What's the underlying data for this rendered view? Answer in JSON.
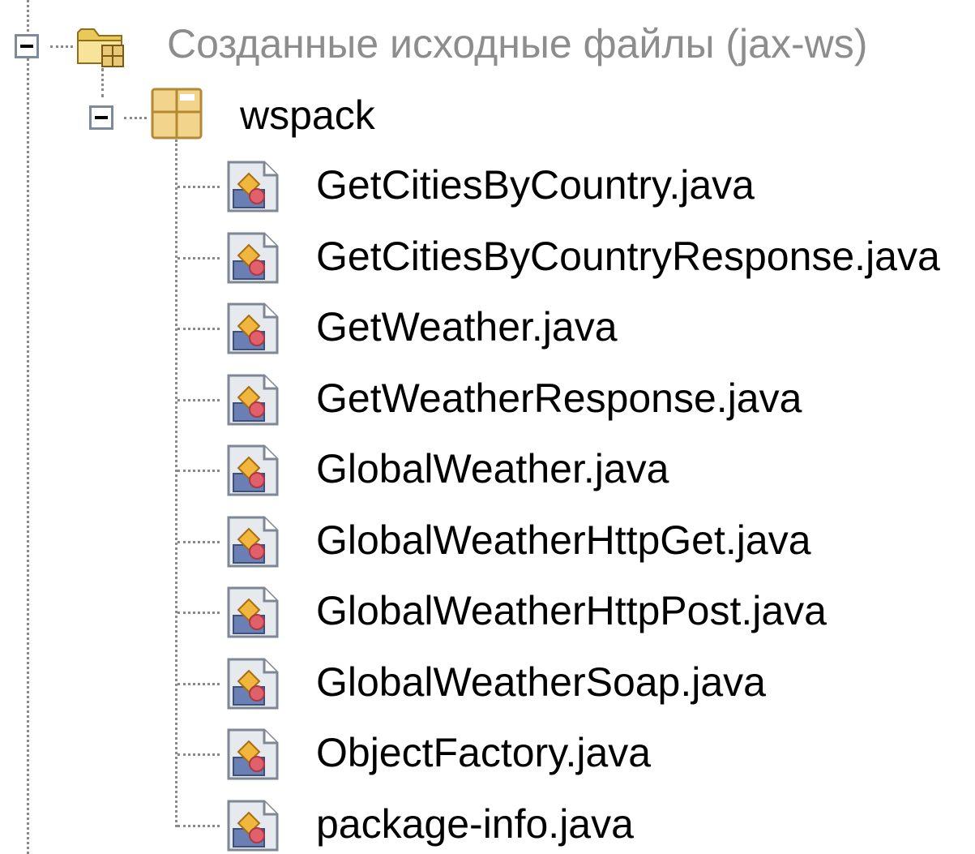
{
  "tree": {
    "root": {
      "label": "Созданные исходные файлы (jax-ws)",
      "expanded": true,
      "icon": "source-folder-icon",
      "package": {
        "label": "wspack",
        "expanded": true,
        "icon": "package-icon",
        "files": [
          {
            "label": "GetCitiesByCountry.java",
            "icon": "java-file-icon"
          },
          {
            "label": "GetCitiesByCountryResponse.java",
            "icon": "java-file-icon"
          },
          {
            "label": "GetWeather.java",
            "icon": "java-file-icon"
          },
          {
            "label": "GetWeatherResponse.java",
            "icon": "java-file-icon"
          },
          {
            "label": "GlobalWeather.java",
            "icon": "java-file-icon"
          },
          {
            "label": "GlobalWeatherHttpGet.java",
            "icon": "java-file-icon"
          },
          {
            "label": "GlobalWeatherHttpPost.java",
            "icon": "java-file-icon"
          },
          {
            "label": "GlobalWeatherSoap.java",
            "icon": "java-file-icon"
          },
          {
            "label": "ObjectFactory.java",
            "icon": "java-file-icon"
          },
          {
            "label": "package-info.java",
            "icon": "java-file-icon"
          }
        ]
      }
    }
  },
  "colors": {
    "root_label": "#8d8d8d",
    "label": "#000000",
    "tree_lines": "#8a8a8a",
    "expander_border": "#7d8a99"
  }
}
